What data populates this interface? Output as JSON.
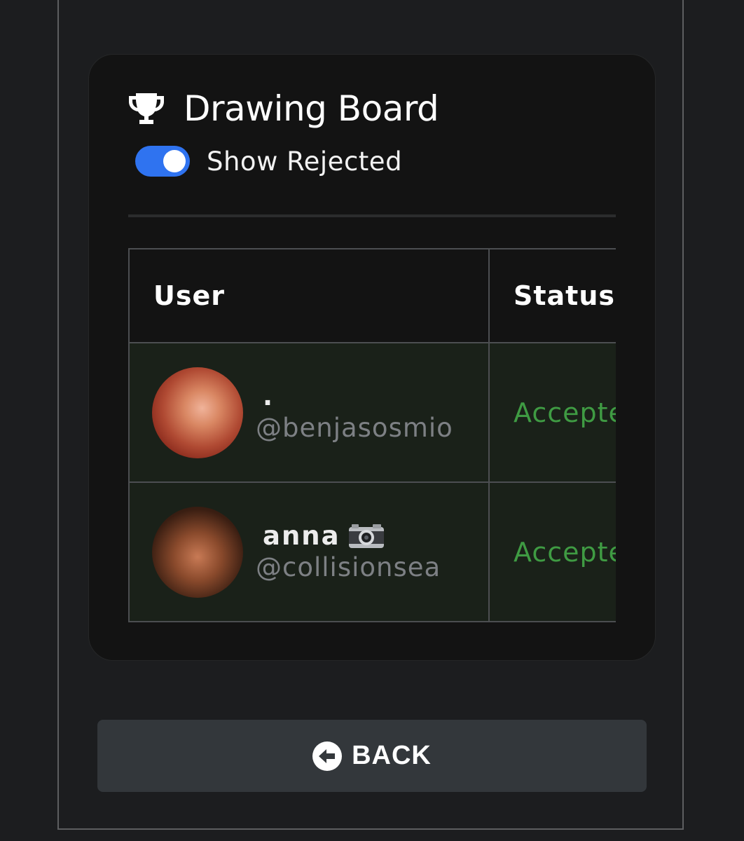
{
  "card": {
    "title": "Drawing Board",
    "title_icon": "trophy-icon",
    "toggle": {
      "label": "Show Rejected",
      "checked": true,
      "color": "#2f73f0"
    }
  },
  "table": {
    "columns": [
      "User",
      "Status"
    ],
    "rows": [
      {
        "display_name": ".",
        "handle": "@benjasosmio",
        "status": "Accepted"
      },
      {
        "display_name": "anna",
        "display_name_icon": "camera-icon",
        "handle": "@collisionsea",
        "status": "Accepted"
      }
    ],
    "status_color": "#3f9b43"
  },
  "back_button": {
    "label": "BACK",
    "icon": "arrow-left-circle-icon"
  }
}
